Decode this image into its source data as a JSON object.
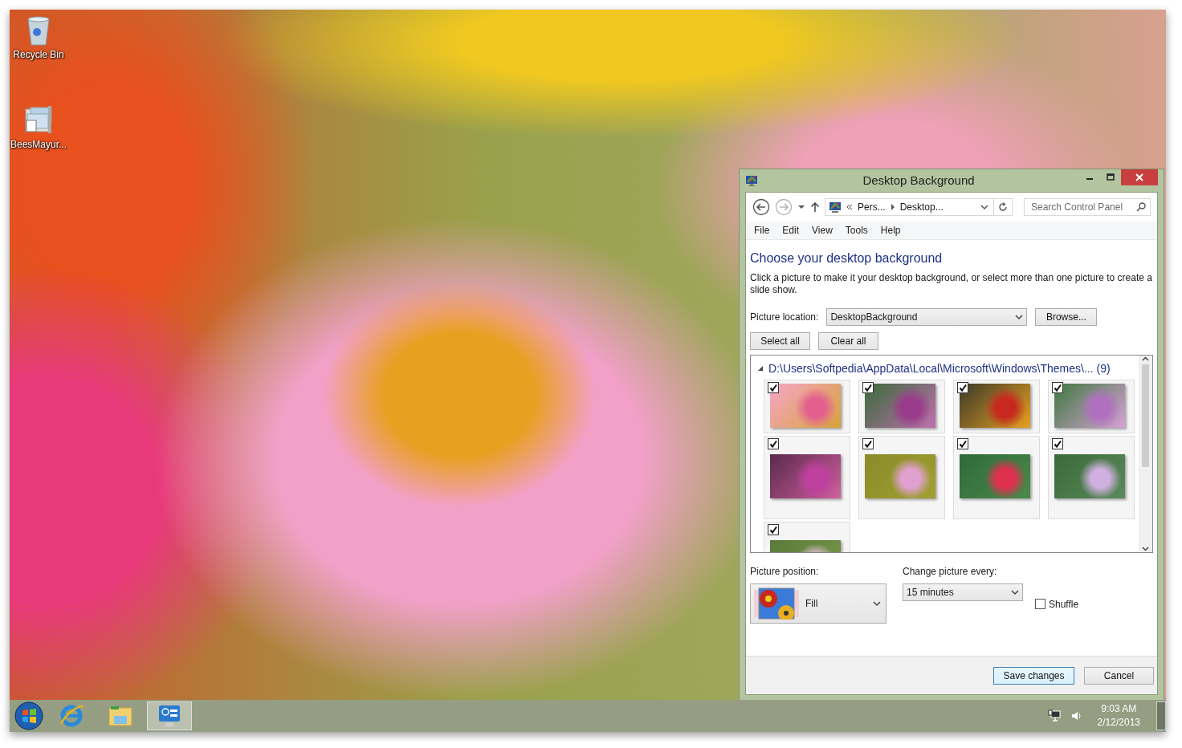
{
  "desktop": {
    "icons": [
      {
        "label": "Recycle Bin",
        "kind": "recycle-bin"
      },
      {
        "label": "BeesMayur...",
        "kind": "theme-pack"
      }
    ]
  },
  "window": {
    "title": "Desktop Background",
    "nav": {
      "back": {
        "disabled": false
      },
      "forward": {
        "disabled": true
      }
    },
    "address": {
      "segments": [
        "Pers...",
        "Desktop..."
      ]
    },
    "search": {
      "placeholder": "Search Control Panel"
    },
    "menu": [
      "File",
      "Edit",
      "View",
      "Tools",
      "Help"
    ],
    "heading": "Choose your desktop background",
    "description": "Click a picture to make it your desktop background, or select more than one picture to create a slide show.",
    "picture_location": {
      "label": "Picture location:",
      "value": "DesktopBackground"
    },
    "browse_button": "Browse...",
    "select_buttons": [
      "Select all",
      "Clear all"
    ],
    "group": {
      "path": "D:\\Users\\Softpedia\\AppData\\Local\\Microsoft\\Windows\\Themes\\... (9)",
      "expanded": true
    },
    "pictures": [
      {
        "checked": true
      },
      {
        "checked": true
      },
      {
        "checked": true
      },
      {
        "checked": true
      },
      {
        "checked": true
      },
      {
        "checked": true
      },
      {
        "checked": true
      },
      {
        "checked": true
      },
      {
        "checked": true
      }
    ],
    "picture_position": {
      "label": "Picture position:",
      "value": "Fill"
    },
    "change_every": {
      "label": "Change picture every:",
      "value": "15 minutes"
    },
    "shuffle": {
      "label": "Shuffle",
      "checked": false
    },
    "buttons": [
      {
        "label": "Save changes",
        "default": true
      },
      {
        "label": "Cancel",
        "default": false
      }
    ]
  },
  "taskbar": {
    "apps": [
      {
        "kind": "internet-explorer",
        "selected": false
      },
      {
        "kind": "file-explorer",
        "selected": false
      },
      {
        "kind": "control-panel",
        "selected": true
      }
    ],
    "clock": {
      "time": "9:03 AM",
      "date": "2/12/2013"
    }
  }
}
